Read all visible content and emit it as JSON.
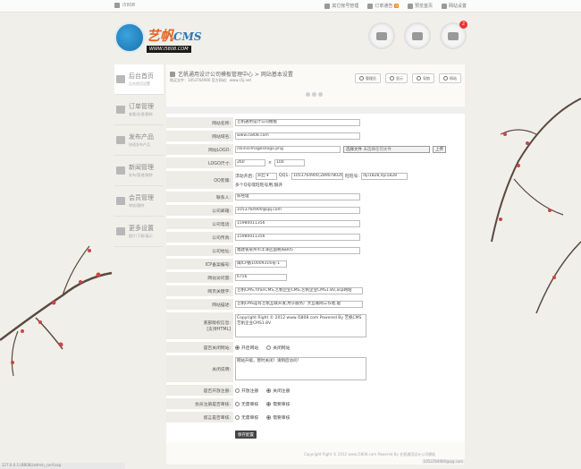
{
  "topbar": {
    "home_url": "i5808",
    "links": [
      {
        "label": "其它帐号管理",
        "icon": "document-icon"
      },
      {
        "label": "订单通告",
        "icon": "mail-icon",
        "badge": "0"
      },
      {
        "label": "预览首页",
        "icon": "cloud-icon"
      },
      {
        "label": "网站设置",
        "icon": "gear-icon"
      }
    ]
  },
  "logo": {
    "brand": "艺帆",
    "brand_latin": "CMS",
    "url": "WWW.I5808.COM"
  },
  "header_buttons": [
    {
      "icon": "user-group-icon"
    },
    {
      "icon": "truck-icon"
    },
    {
      "icon": "chat-icon",
      "badge": "2"
    }
  ],
  "sidebar": {
    "items": [
      {
        "title": "后台首页",
        "sub": "后台首页设置",
        "active": true
      },
      {
        "title": "订单管理",
        "sub": "查看/处理/删除"
      },
      {
        "title": "发布产品",
        "sub": "快速发布产品"
      },
      {
        "title": "新闻管理",
        "sub": "发布/管理/删除"
      },
      {
        "title": "会员管理",
        "sub": "审核/删除"
      },
      {
        "title": "更多设置",
        "sub": "图片/下载/展示"
      }
    ]
  },
  "main": {
    "breadcrumb": "艺帆通用设计公司模板管理中心 > 网站基本设置",
    "subcrumb": "购买文件：1053764900  官方网站：www.s5j.net",
    "tool_buttons": [
      "管理员",
      "显示",
      "导航",
      "网站"
    ],
    "form": {
      "site_name_label": "网站名称:",
      "site_name": "艺帆通用设计公司模板",
      "domain_label": "网站域名:",
      "domain": "www.i5808.com",
      "logo_label": "网站LOGO:",
      "logo_path": "/skins/images/logo.png",
      "file_btn": "选择文件",
      "file_none": "未选择任何文件",
      "upload_btn": "上传",
      "logo_size_label": "LOGO尺寸:",
      "logo_w": "260",
      "logo_x": "×",
      "logo_h": "100",
      "qq_label": "QQ客服:",
      "qq_open_label": "浮动开启:",
      "qq_open_value": "开启",
      "qq_num_label": "QQ1:",
      "qq_num": "1053764900,289078026",
      "wangwang_label": "旺旺号:",
      "wangwang": "dyi1828,dyi1828",
      "qq_hint": "多个Q号或旺旺号用,隔开",
      "contact_label": "联系人:",
      "contact": "陈经理",
      "email_label": "公司邮箱:",
      "email": "1053764900@qq.com",
      "phone_label": "公司电话:",
      "phone": "15980011356",
      "fax_label": "公司传真:",
      "fax": "15980011356",
      "address_label": "公司地址:",
      "address": "福建省泉州市丰泽区国税局B05",
      "icp_label": "ICP备案编号:",
      "icp": "闽ICP备10009316号-1",
      "visits_label": "网站访问量:",
      "visits": "6756",
      "keywords_label": "网页关键字:",
      "keywords": "艺帆CMS,YifanCMS,艺帆企业CMS,艺帆企业CMS1.8V,asp网站",
      "desc_label": "网站描述:",
      "desc": "艺帆CMS是有艺帆互联开发,用于服务广大互联网工作者,能",
      "copyright_label": "底部版权信息:",
      "copyright_label2": "[支持HTML]",
      "copyright_text": "Copyright Right © 2012 www.i5808.com Powered By 艺帆CMS 艺帆企业CMS1.8V",
      "closesite_label": "是否关闭网站:",
      "open_site": "开启网站",
      "close_site": "关闭网站",
      "closemsg_label": "关闭说明:",
      "closemsg": "网站升级，暂时关闭！请稍后访问！",
      "register_label": "是否开放注册:",
      "reg_close": "开放注册",
      "reg_open": "关闭注册",
      "review_label": "会员注册是否审核:",
      "review_no": "无需审核",
      "review_yes": "需要审核",
      "msg_label": "留言是否审核:",
      "msg_no": "无需审核",
      "msg_yes": "需要审核",
      "save": "保存配置"
    }
  },
  "footer": {
    "copyright": "Copyright Right © 2012 www.i5808.com Powered By 艺帆通用设计公司模板",
    "status": "127.0.0.1:(8808)/admin_conf.asp",
    "corner": "1053764900@qq.com"
  }
}
